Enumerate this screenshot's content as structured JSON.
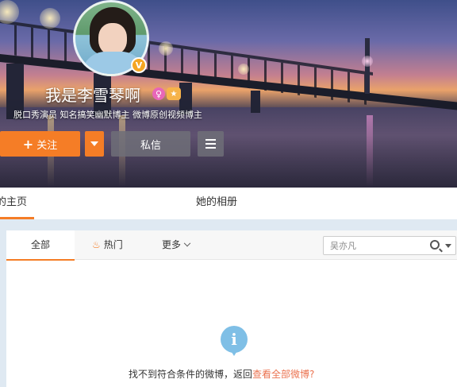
{
  "profile": {
    "name": "我是李雪琴啊",
    "verified_badge": "V",
    "gender_icon": "female-icon",
    "level_icon": "level-badge-icon",
    "description": "脱口秀演员 知名搞笑幽默博主 微博原创视频博主"
  },
  "actions": {
    "follow_plus": "+",
    "follow_label": "关注",
    "message_label": "私信"
  },
  "profile_tabs": {
    "home": "的主页",
    "album": "她的相册"
  },
  "feed_tabs": {
    "all": "全部",
    "hot": "热门",
    "more": "更多"
  },
  "search": {
    "placeholder": "吴亦凡"
  },
  "empty_state": {
    "icon_char": "i",
    "message": "找不到符合条件的微博，返回",
    "link": "查看全部微博?"
  },
  "colors": {
    "accent": "#f57d26",
    "link": "#eb7350",
    "info": "#7fbfe6"
  }
}
